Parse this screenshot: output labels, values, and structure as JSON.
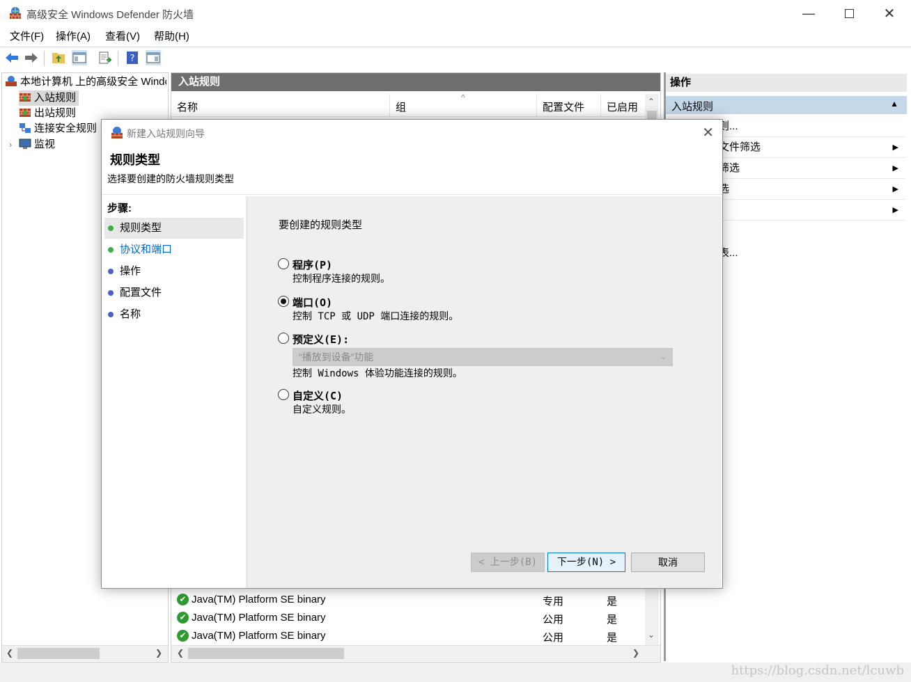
{
  "window": {
    "title": "高级安全 Windows Defender 防火墙",
    "icon": "firewall-icon"
  },
  "menu": [
    "文件(F)",
    "操作(A)",
    "查看(V)",
    "帮助(H)"
  ],
  "toolbar": {
    "icons": [
      "back-arrow-icon",
      "forward-arrow-icon",
      "up-folder-icon",
      "show-hide-tree-icon",
      "export-list-icon",
      "help-icon",
      "show-hide-action-pane-icon"
    ]
  },
  "tree": {
    "root": "本地计算机 上的高级安全 Windows Defender 防火墙",
    "items": [
      {
        "label": "入站规则",
        "icon": "inbound-rules-icon",
        "selected": true
      },
      {
        "label": "出站规则",
        "icon": "outbound-rules-icon"
      },
      {
        "label": "连接安全规则",
        "icon": "connection-security-icon"
      },
      {
        "label": "监视",
        "icon": "monitor-icon",
        "expand_arrow": "›"
      }
    ]
  },
  "middle": {
    "header": "入站规则",
    "columns": [
      "名称",
      "组",
      "配置文件",
      "已启用"
    ],
    "sort_indicator": "^",
    "rows": [
      {
        "name": "Java(TM) Platform SE binary",
        "profile": "专用",
        "enabled": "是"
      },
      {
        "name": "Java(TM) Platform SE binary",
        "profile": "公用",
        "enabled": "是"
      },
      {
        "name": "Java(TM) Platform SE binary",
        "profile": "公用",
        "enabled": "是"
      }
    ]
  },
  "actions": {
    "header": "操作",
    "section": "入站规则",
    "items": [
      "则...",
      "文件筛选",
      "筛选",
      "选",
      "",
      "表..."
    ]
  },
  "dialog": {
    "title": "新建入站规则向导",
    "heading": "规则类型",
    "subheading": "选择要创建的防火墙规则类型",
    "steps_title": "步骤:",
    "steps": [
      {
        "label": "规则类型",
        "color": "#3cb043",
        "current": true
      },
      {
        "label": "协议和端口",
        "color": "#3cb043",
        "link": true
      },
      {
        "label": "操作",
        "color": "#4a5fd0"
      },
      {
        "label": "配置文件",
        "color": "#4a5fd0"
      },
      {
        "label": "名称",
        "color": "#4a5fd0"
      }
    ],
    "question": "要创建的规则类型",
    "options": [
      {
        "label": "程序(P)",
        "desc": "控制程序连接的规则。",
        "selected": false
      },
      {
        "label": "端口(O)",
        "desc": "控制 TCP 或 UDP 端口连接的规则。",
        "selected": true
      },
      {
        "label": "预定义(E):",
        "desc": "控制 Windows 体验功能连接的规则。",
        "selected": false,
        "dropdown": "“播放到设备”功能"
      },
      {
        "label": "自定义(C)",
        "desc": "自定义规则。",
        "selected": false
      }
    ],
    "buttons": {
      "back": "< 上一步(B)",
      "next": "下一步(N) >",
      "cancel": "取消"
    }
  },
  "watermark": "https://blog.csdn.net/lcuwb"
}
